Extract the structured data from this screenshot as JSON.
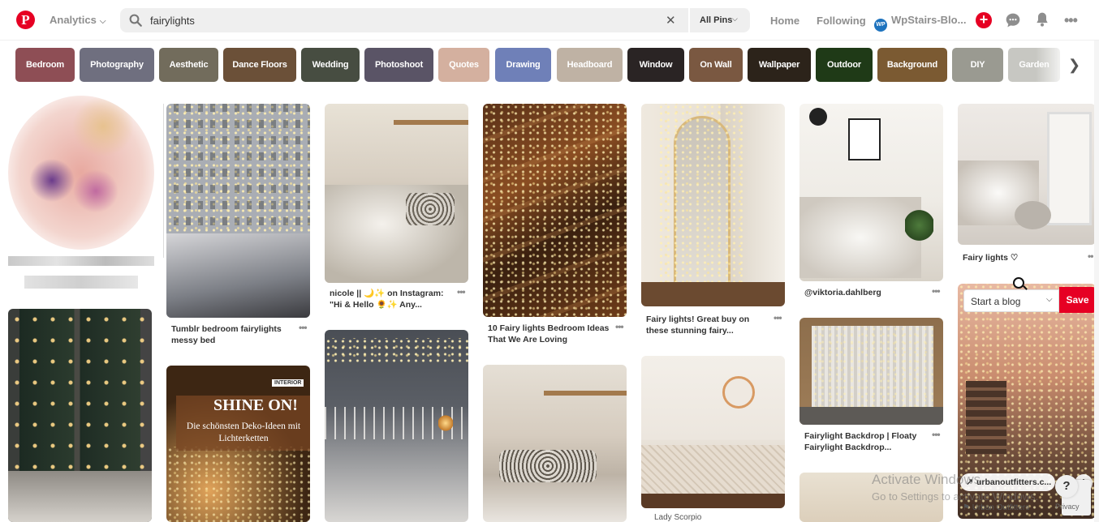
{
  "header": {
    "logo": "P",
    "analytics_label": "Analytics",
    "search_value": "fairylights",
    "search_scope": "All Pins",
    "nav_home": "Home",
    "nav_following": "Following",
    "profile_badge": "WP",
    "profile_name": "WpStairs-Blo..."
  },
  "categories": [
    {
      "label": "Bedroom",
      "color": "#8e4e55"
    },
    {
      "label": "Photography",
      "color": "#6f6f7f"
    },
    {
      "label": "Aesthetic",
      "color": "#726c5c"
    },
    {
      "label": "Dance Floors",
      "color": "#6b5038"
    },
    {
      "label": "Wedding",
      "color": "#474d41"
    },
    {
      "label": "Photoshoot",
      "color": "#5a5466"
    },
    {
      "label": "Quotes",
      "color": "#d4b09f"
    },
    {
      "label": "Drawing",
      "color": "#6f80b8"
    },
    {
      "label": "Headboard",
      "color": "#bfb2a4"
    },
    {
      "label": "Window",
      "color": "#2a2424"
    },
    {
      "label": "On Wall",
      "color": "#7a5841"
    },
    {
      "label": "Wallpaper",
      "color": "#2c231a"
    },
    {
      "label": "Outdoor",
      "color": "#1f3a17"
    },
    {
      "label": "Background",
      "color": "#7b5a32"
    },
    {
      "label": "DIY",
      "color": "#9a9a91"
    },
    {
      "label": "Garden",
      "color": "#c7c7c2"
    }
  ],
  "pins": {
    "tumblr": {
      "title": "Tumblr bedroom fairylights messy bed"
    },
    "nicole": {
      "title": "nicole || 🌙✨ on Instagram: \"Hi & Hello 🌻✨ Any..."
    },
    "ten_lights": {
      "title": "10 Fairy lights Bedroom Ideas That We Are Loving"
    },
    "fairy_buy": {
      "title": "Fairy lights! Great buy on these stunning fairy..."
    },
    "viktoria": {
      "title": "@viktoria.dahlberg"
    },
    "fairy_heart": {
      "title": "Fairy lights ♡"
    },
    "backdrop": {
      "title": "Fairylight Backdrop | Floaty Fairylight Backdrop..."
    },
    "scorpio": {
      "title": "Lady Scorpio"
    },
    "shine": {
      "tag": "INTERIOR",
      "headline": "SHINE ON!",
      "subline": "Die schönsten Deko-Ideen mit Lichterketten"
    }
  },
  "save_popup": {
    "board": "Start a blog",
    "save_label": "Save",
    "source_domain": "urbanoutfitters.c...",
    "source_name": "Urban Outfitters"
  },
  "overlay": {
    "watermark_line1": "Activate Windows",
    "watermark_line2": "Go to Settings to activate Windows.",
    "help": "?",
    "privacy": "Privacy"
  }
}
